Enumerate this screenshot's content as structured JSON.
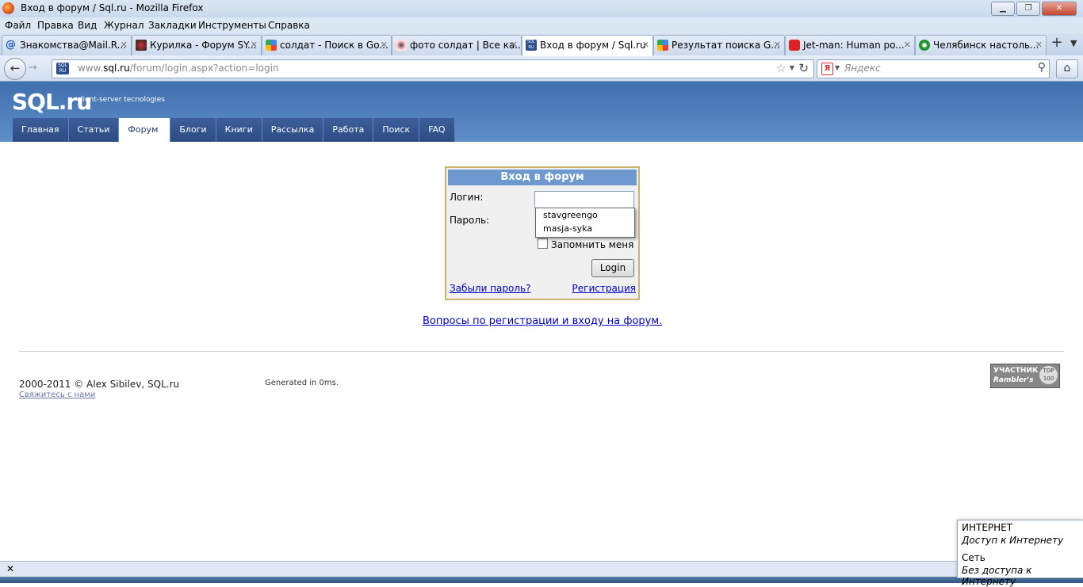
{
  "window": {
    "title": "Вход в форум / Sql.ru - Mozilla Firefox"
  },
  "menu": [
    "Файл",
    "Правка",
    "Вид",
    "Журнал",
    "Закладки",
    "Инструменты",
    "Справка"
  ],
  "tabs": [
    {
      "label": "Знакомства@Mail.R...",
      "icon": "at-icon"
    },
    {
      "label": "Курилка - Форум SY...",
      "icon": "forum-icon"
    },
    {
      "label": "солдат - Поиск в Go...",
      "icon": "google-icon"
    },
    {
      "label": "фото солдат | Все ка...",
      "icon": "eye-icon"
    },
    {
      "label": "Вход в форум / Sql.ru",
      "icon": "sqlru-icon"
    },
    {
      "label": "Результат поиска G...",
      "icon": "google-icon"
    },
    {
      "label": "Jet-man: Human po...",
      "icon": "youtube-icon"
    },
    {
      "label": "Челябинск настоль...",
      "icon": "green-eye-icon"
    }
  ],
  "navbar": {
    "url_prefix": "www.",
    "url_domain": "sql.ru",
    "url_path": "/forum/login.aspx?action=login",
    "site_badge": "SQL RU",
    "search_placeholder": "Яндекс",
    "search_engine_letter": "Я"
  },
  "site": {
    "logo": "SQL.ru",
    "tagline": "client-server tecnologies",
    "nav": [
      "Главная",
      "Статьи",
      "Форум",
      "Блоги",
      "Книги",
      "Рассылка",
      "Работа",
      "Поиск",
      "FAQ"
    ],
    "active_nav": "Форум"
  },
  "login": {
    "heading": "Вход в форум",
    "login_label": "Логин:",
    "password_label": "Пароль:",
    "login_value": "",
    "autocomplete": [
      "stavgreengo",
      "masja-syka"
    ],
    "remember_label": "Запомнить меня",
    "remember_checked": false,
    "button": "Login",
    "forgot": "Забыли пароль?",
    "register": "Регистрация"
  },
  "help_link": "Вопросы по регистрации и входу на форум.",
  "footer": {
    "copyright": "2000-2011 © Alex Sibilev, SQL.ru",
    "contact": "Свяжитесь с нами",
    "generated": "Generated in 0ms.",
    "rambler_line1": "УЧАСТНИК",
    "rambler_line2": "Rambler's",
    "rambler_badge": "TOP 100"
  },
  "network_popup": {
    "title": "ИНТЕРНЕТ",
    "subtitle": "Доступ к Интернету",
    "net_title": "Сеть",
    "net_subtitle": "Без доступа к Интернету"
  },
  "colors": {
    "header": "#4a7bbb",
    "nav": "#2f5088",
    "link": "#0000cc",
    "login_head": "#6d99cf"
  }
}
